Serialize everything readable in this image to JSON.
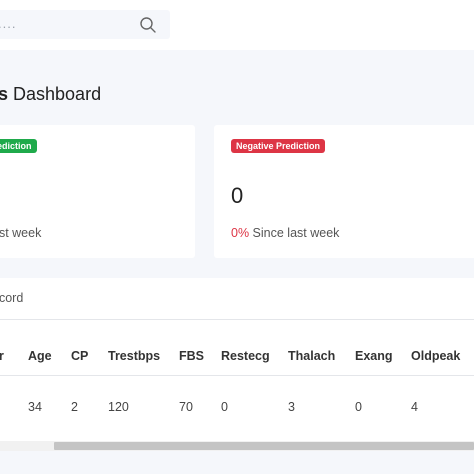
{
  "search": {
    "placeholder": "...."
  },
  "page": {
    "title_bold": "s",
    "title_rest": " Dashboard"
  },
  "cards": [
    {
      "badge": "ediction",
      "badge_color": "#1faa4b",
      "value": "",
      "footer_pct": "",
      "footer_text": "ast week"
    },
    {
      "badge": "Negative Prediction",
      "badge_color": "#dd3545",
      "value": "0",
      "footer_pct": "0%",
      "footer_text": " Since last week"
    }
  ],
  "table": {
    "title": "ecord",
    "headers": [
      "er",
      "Age",
      "CP",
      "Trestbps",
      "FBS",
      "Restecg",
      "Thalach",
      "Exang",
      "Oldpeak"
    ],
    "rows": [
      [
        "",
        "34",
        "2",
        "120",
        "70",
        "0",
        "3",
        "0",
        "4"
      ]
    ]
  },
  "colors": {
    "accent_green": "#1faa4b",
    "accent_red": "#dd3545"
  }
}
